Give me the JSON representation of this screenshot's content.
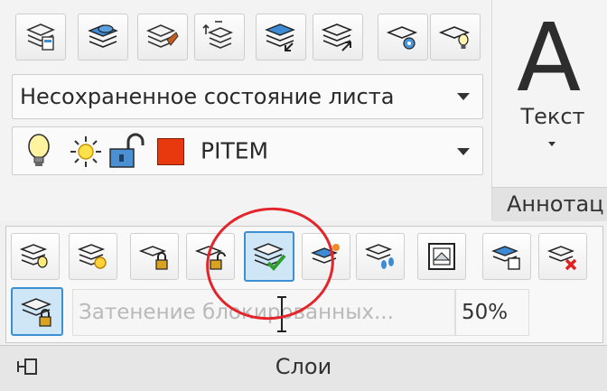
{
  "top": {
    "layer_state_dropdown": "Несохраненное состояние листа",
    "layer_dropdown": "PITEM",
    "layer_color": "#e8380d"
  },
  "annotation": {
    "big_glyph": "A",
    "text_label": "Текст",
    "panel_label": "Аннотац"
  },
  "flyout": {
    "transparency_placeholder": "Затенение блокированных...",
    "transparency_value": "50%"
  },
  "panel": {
    "title": "Слои"
  },
  "colors": {
    "accent": "#3c8fd1",
    "highlight": "#e4242b"
  }
}
